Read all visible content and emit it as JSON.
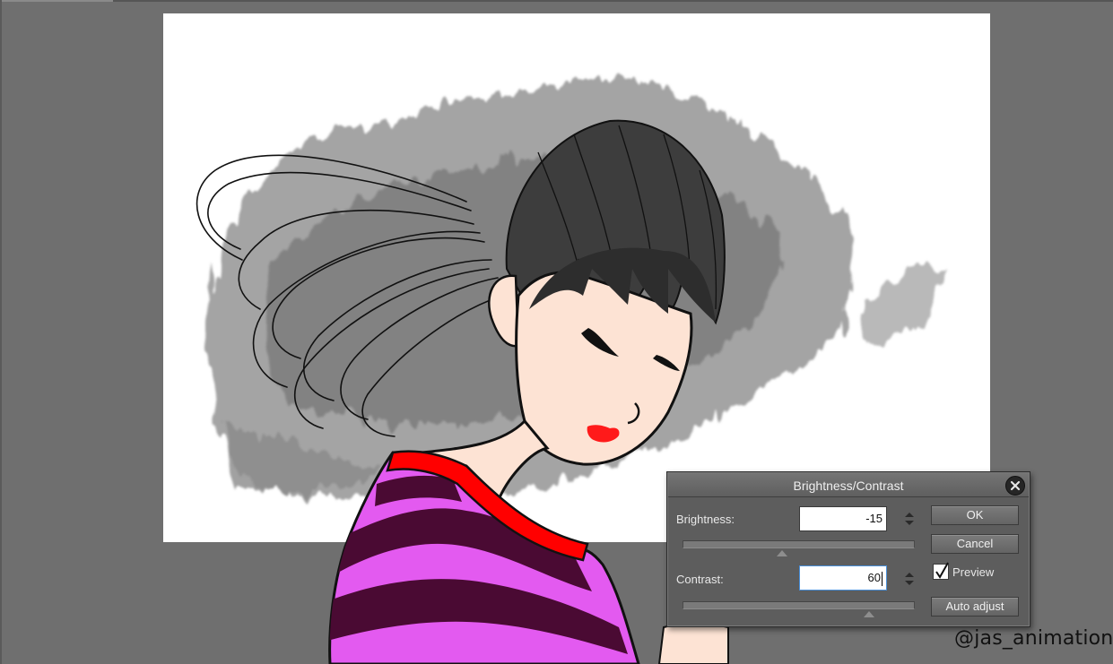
{
  "dialog": {
    "title": "Brightness/Contrast",
    "brightness_label": "Brightness:",
    "brightness_value": "-15",
    "contrast_label": "Contrast:",
    "contrast_value": "60",
    "ok_label": "OK",
    "cancel_label": "Cancel",
    "preview_label": "Preview",
    "preview_checked": true,
    "auto_adjust_label": "Auto adjust"
  },
  "watermark": "@jas_animation",
  "colors": {
    "workspace": "#6f6f6f",
    "canvas": "#ffffff",
    "skin": "#fde3d4",
    "lips": "#ff1a1a",
    "shirt_pink": "#e35af0",
    "shirt_stripe": "#4a0a33",
    "collar": "#ff0000",
    "dialog_bg": "#5d5d5d"
  }
}
